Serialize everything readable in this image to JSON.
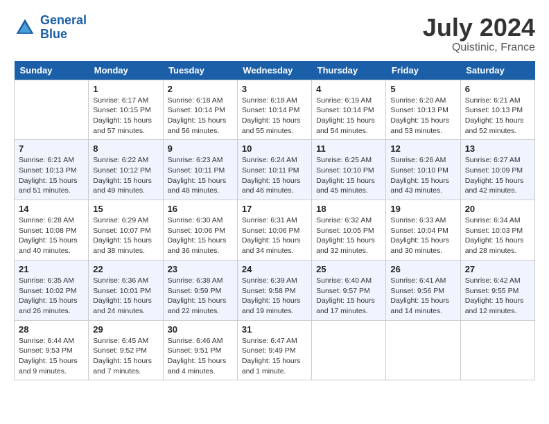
{
  "header": {
    "logo_line1": "General",
    "logo_line2": "Blue",
    "month_year": "July 2024",
    "location": "Quistinic, France"
  },
  "weekdays": [
    "Sunday",
    "Monday",
    "Tuesday",
    "Wednesday",
    "Thursday",
    "Friday",
    "Saturday"
  ],
  "weeks": [
    [
      {
        "day": "",
        "info": ""
      },
      {
        "day": "1",
        "info": "Sunrise: 6:17 AM\nSunset: 10:15 PM\nDaylight: 15 hours\nand 57 minutes."
      },
      {
        "day": "2",
        "info": "Sunrise: 6:18 AM\nSunset: 10:14 PM\nDaylight: 15 hours\nand 56 minutes."
      },
      {
        "day": "3",
        "info": "Sunrise: 6:18 AM\nSunset: 10:14 PM\nDaylight: 15 hours\nand 55 minutes."
      },
      {
        "day": "4",
        "info": "Sunrise: 6:19 AM\nSunset: 10:14 PM\nDaylight: 15 hours\nand 54 minutes."
      },
      {
        "day": "5",
        "info": "Sunrise: 6:20 AM\nSunset: 10:13 PM\nDaylight: 15 hours\nand 53 minutes."
      },
      {
        "day": "6",
        "info": "Sunrise: 6:21 AM\nSunset: 10:13 PM\nDaylight: 15 hours\nand 52 minutes."
      }
    ],
    [
      {
        "day": "7",
        "info": "Sunrise: 6:21 AM\nSunset: 10:13 PM\nDaylight: 15 hours\nand 51 minutes."
      },
      {
        "day": "8",
        "info": "Sunrise: 6:22 AM\nSunset: 10:12 PM\nDaylight: 15 hours\nand 49 minutes."
      },
      {
        "day": "9",
        "info": "Sunrise: 6:23 AM\nSunset: 10:11 PM\nDaylight: 15 hours\nand 48 minutes."
      },
      {
        "day": "10",
        "info": "Sunrise: 6:24 AM\nSunset: 10:11 PM\nDaylight: 15 hours\nand 46 minutes."
      },
      {
        "day": "11",
        "info": "Sunrise: 6:25 AM\nSunset: 10:10 PM\nDaylight: 15 hours\nand 45 minutes."
      },
      {
        "day": "12",
        "info": "Sunrise: 6:26 AM\nSunset: 10:10 PM\nDaylight: 15 hours\nand 43 minutes."
      },
      {
        "day": "13",
        "info": "Sunrise: 6:27 AM\nSunset: 10:09 PM\nDaylight: 15 hours\nand 42 minutes."
      }
    ],
    [
      {
        "day": "14",
        "info": "Sunrise: 6:28 AM\nSunset: 10:08 PM\nDaylight: 15 hours\nand 40 minutes."
      },
      {
        "day": "15",
        "info": "Sunrise: 6:29 AM\nSunset: 10:07 PM\nDaylight: 15 hours\nand 38 minutes."
      },
      {
        "day": "16",
        "info": "Sunrise: 6:30 AM\nSunset: 10:06 PM\nDaylight: 15 hours\nand 36 minutes."
      },
      {
        "day": "17",
        "info": "Sunrise: 6:31 AM\nSunset: 10:06 PM\nDaylight: 15 hours\nand 34 minutes."
      },
      {
        "day": "18",
        "info": "Sunrise: 6:32 AM\nSunset: 10:05 PM\nDaylight: 15 hours\nand 32 minutes."
      },
      {
        "day": "19",
        "info": "Sunrise: 6:33 AM\nSunset: 10:04 PM\nDaylight: 15 hours\nand 30 minutes."
      },
      {
        "day": "20",
        "info": "Sunrise: 6:34 AM\nSunset: 10:03 PM\nDaylight: 15 hours\nand 28 minutes."
      }
    ],
    [
      {
        "day": "21",
        "info": "Sunrise: 6:35 AM\nSunset: 10:02 PM\nDaylight: 15 hours\nand 26 minutes."
      },
      {
        "day": "22",
        "info": "Sunrise: 6:36 AM\nSunset: 10:01 PM\nDaylight: 15 hours\nand 24 minutes."
      },
      {
        "day": "23",
        "info": "Sunrise: 6:38 AM\nSunset: 9:59 PM\nDaylight: 15 hours\nand 22 minutes."
      },
      {
        "day": "24",
        "info": "Sunrise: 6:39 AM\nSunset: 9:58 PM\nDaylight: 15 hours\nand 19 minutes."
      },
      {
        "day": "25",
        "info": "Sunrise: 6:40 AM\nSunset: 9:57 PM\nDaylight: 15 hours\nand 17 minutes."
      },
      {
        "day": "26",
        "info": "Sunrise: 6:41 AM\nSunset: 9:56 PM\nDaylight: 15 hours\nand 14 minutes."
      },
      {
        "day": "27",
        "info": "Sunrise: 6:42 AM\nSunset: 9:55 PM\nDaylight: 15 hours\nand 12 minutes."
      }
    ],
    [
      {
        "day": "28",
        "info": "Sunrise: 6:44 AM\nSunset: 9:53 PM\nDaylight: 15 hours\nand 9 minutes."
      },
      {
        "day": "29",
        "info": "Sunrise: 6:45 AM\nSunset: 9:52 PM\nDaylight: 15 hours\nand 7 minutes."
      },
      {
        "day": "30",
        "info": "Sunrise: 6:46 AM\nSunset: 9:51 PM\nDaylight: 15 hours\nand 4 minutes."
      },
      {
        "day": "31",
        "info": "Sunrise: 6:47 AM\nSunset: 9:49 PM\nDaylight: 15 hours\nand 1 minute."
      },
      {
        "day": "",
        "info": ""
      },
      {
        "day": "",
        "info": ""
      },
      {
        "day": "",
        "info": ""
      }
    ]
  ]
}
